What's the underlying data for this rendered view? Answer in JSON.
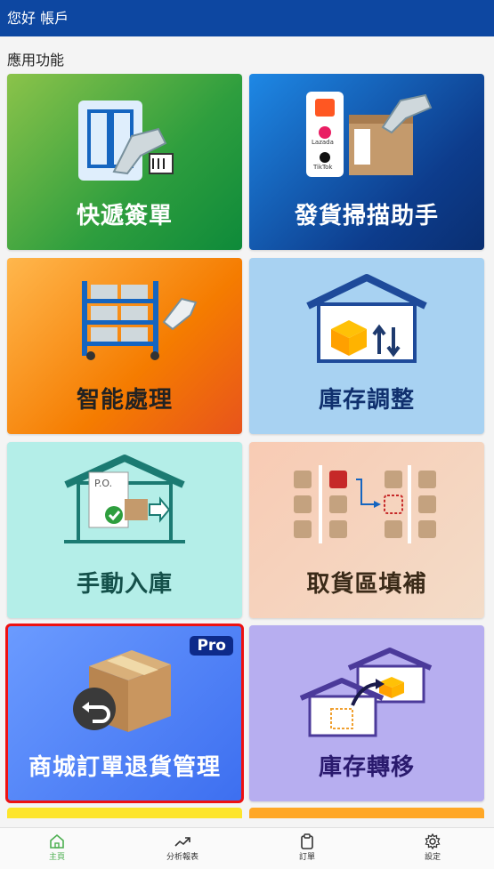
{
  "header": {
    "title": "您好 帳戶"
  },
  "section": {
    "title": "應用功能"
  },
  "tiles": [
    {
      "label": "快遞簽單",
      "text_color": "#ffffff"
    },
    {
      "label": "發貨掃描助手",
      "text_color": "#ffffff",
      "logos": [
        "Lazada",
        "TikTok"
      ]
    },
    {
      "label": "智能處理",
      "text_color": "#222222"
    },
    {
      "label": "庫存調整",
      "text_color": "#10306e"
    },
    {
      "label": "手動入庫",
      "text_color": "#14504a"
    },
    {
      "label": "取貨區填補",
      "text_color": "#3a2a18"
    },
    {
      "label": "商城訂單退貨管理",
      "text_color": "#ffffff",
      "badge": "Pro",
      "selected": true
    },
    {
      "label": "庫存轉移",
      "text_color": "#2a1a6e"
    }
  ],
  "nav": [
    {
      "label": "主頁",
      "icon": "home-icon",
      "active": true
    },
    {
      "label": "分析報表",
      "icon": "trend-icon",
      "active": false
    },
    {
      "label": "訂單",
      "icon": "clipboard-icon",
      "active": false
    },
    {
      "label": "設定",
      "icon": "gear-icon",
      "active": false
    }
  ],
  "colors": {
    "brand": "#0d47a1",
    "active_nav": "#4caf50",
    "selected_outline": "#e11111"
  }
}
